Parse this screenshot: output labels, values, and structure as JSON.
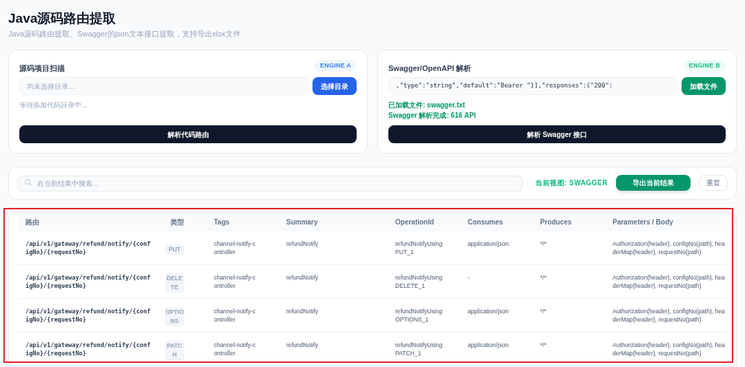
{
  "header": {
    "title": "Java源码路由提取",
    "subtitle": "Java源码路由提取、Swagger的json文本接口提取，支持导出xlsx文件"
  },
  "engines": [
    {
      "kind": "folder",
      "title": "源码项目扫描",
      "badge": "ENGINE A",
      "field": {
        "placeholder": "尚未选择目录..."
      },
      "pick_button": "选择目录",
      "status": [
        "等待添加代码目录中..."
      ],
      "run_button": "解析代码路由"
    },
    {
      "kind": "swagger",
      "title": "Swagger/OpenAPI 解析",
      "badge": "ENGINE B",
      "field": {
        "value": ",\"type\":\"string\",\"default\":\"Bearer \"}],\"responses\":{\"200\":"
      },
      "pick_button": "加载文件",
      "status": [
        "已加载文件: swagger.txt",
        "Swagger 解析完成: 616 API"
      ],
      "run_button": "解析 Swagger 接口"
    }
  ],
  "toolbar": {
    "search": {
      "placeholder": "在当前结果中搜索..."
    },
    "view_label": "当前视图: SWAGGER",
    "export_button": "导出当前结果",
    "reset_button": "重置"
  },
  "table": {
    "columns": [
      "路由",
      "类型",
      "Tags",
      "Summary",
      "OperationId",
      "Consumes",
      "Produces",
      "Parameters / Body"
    ],
    "rows": [
      [
        "/api/v1/gateway/refund/notify/{configNo}/{requestNo}",
        "PUT",
        "channel-notify-controller",
        "refundNotify",
        "refundNotifyUsingPUT_1",
        "application/json",
        "*/*",
        "Authorization(header), configNo(path), headerMap(header), requestNo(path)"
      ],
      [
        "/api/v1/gateway/refund/notify/{configNo}/{requestNo}",
        "DELETE",
        "channel-notify-controller",
        "refundNotify",
        "refundNotifyUsingDELETE_1",
        "-",
        "*/*",
        "Authorization(header), configNo(path), headerMap(header), requestNo(path)"
      ],
      [
        "/api/v1/gateway/refund/notify/{configNo}/{requestNo}",
        "OPTIONS",
        "channel-notify-controller",
        "refundNotify",
        "refundNotifyUsingOPTIONS_1",
        "application/json",
        "*/*",
        "Authorization(header), configNo(path), headerMap(header), requestNo(path)"
      ],
      [
        "/api/v1/gateway/refund/notify/{configNo}/{requestNo}",
        "PATCH",
        "channel-notify-controller",
        "refundNotify",
        "refundNotifyUsingPATCH_1",
        "application/json",
        "*/*",
        "Authorization(header), configNo(path), headerMap(header), requestNo(path)"
      ]
    ]
  }
}
